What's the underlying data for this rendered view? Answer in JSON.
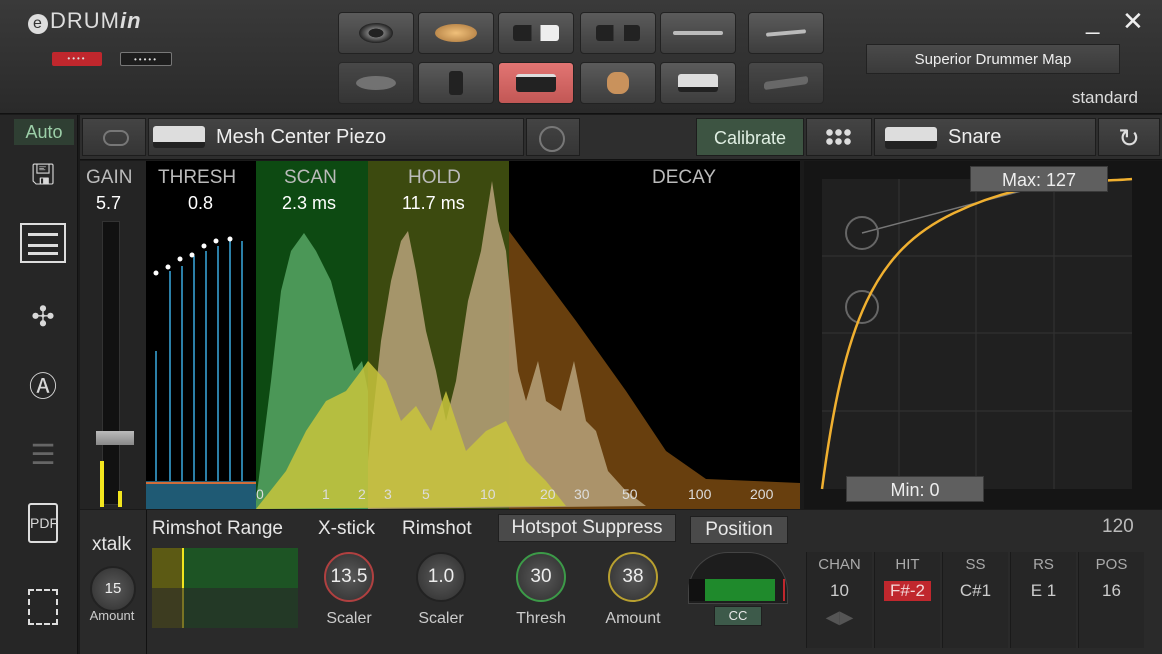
{
  "app": {
    "logo_prefix": "e",
    "logo_main": "DRUM",
    "logo_suffix": "in",
    "port_red": "••••",
    "port_black": "•••••"
  },
  "window": {
    "minimize": "_",
    "close": "✕"
  },
  "map": {
    "name": "Superior Drummer Map",
    "mode": "standard"
  },
  "pads": [
    {
      "icon": "cymbal-icon",
      "selected": false
    },
    {
      "icon": "crash-cymbal-icon",
      "selected": false
    },
    {
      "icon": "snare-kick-icon",
      "selected": false
    },
    {
      "icon": "drum-pair-icon",
      "selected": false
    },
    {
      "icon": "ride-icon",
      "selected": false
    },
    {
      "icon": "stick-icon",
      "selected": false
    },
    {
      "icon": "cymbal-dim-icon",
      "selected": false
    },
    {
      "icon": "floor-tom-icon",
      "selected": false
    },
    {
      "icon": "snare-icon",
      "selected": true
    },
    {
      "icon": "hand-icon",
      "selected": false
    },
    {
      "icon": "drum-icon",
      "selected": false
    },
    {
      "icon": "pedal-icon",
      "selected": false
    }
  ],
  "sidebar": {
    "auto_label": "Auto",
    "items": [
      "save-icon",
      "list-icon",
      "arrows-icon",
      "a-circle-icon",
      "menu-icon",
      "pdf-icon",
      "chip-icon"
    ]
  },
  "header": {
    "pad_type": "Mesh Center Piezo",
    "calibrate": "Calibrate",
    "instrument": "Snare",
    "refresh_icon": "↻"
  },
  "params": {
    "gain_label": "GAIN",
    "gain_value": "5.7",
    "thresh_label": "THRESH",
    "thresh_value": "0.8",
    "scan_label": "SCAN",
    "scan_value": "2.3 ms",
    "hold_label": "HOLD",
    "hold_value": "11.7 ms",
    "decay_label": "DECAY"
  },
  "axis_ticks": [
    "0",
    "1",
    "2",
    "3",
    "5",
    "10",
    "20",
    "30",
    "50",
    "100",
    "200"
  ],
  "curve": {
    "max_label": "Max: 127",
    "min_label": "Min: 0"
  },
  "bottom": {
    "xtalk_label": "xtalk",
    "xtalk_value": "15",
    "xtalk_sub": "Amount",
    "rimshot_range": "Rimshot Range",
    "xstick_label": "X-stick",
    "xstick_value": "13.5",
    "xstick_sub": "Scaler",
    "rimshot_label": "Rimshot",
    "rimshot_value": "1.0",
    "rimshot_sub": "Scaler",
    "hotspot": "Hotspot Suppress",
    "hotspot_thresh": "30",
    "hotspot_thresh_sub": "Thresh",
    "hotspot_amount": "38",
    "hotspot_amount_sub": "Amount",
    "position": "Position",
    "position_cc": "CC",
    "velocity": "120"
  },
  "midi": [
    {
      "h": "CHAN",
      "v": "10"
    },
    {
      "h": "HIT",
      "v": "F#-2"
    },
    {
      "h": "SS",
      "v": "C#1"
    },
    {
      "h": "RS",
      "v": "E 1"
    },
    {
      "h": "POS",
      "v": "16"
    }
  ]
}
